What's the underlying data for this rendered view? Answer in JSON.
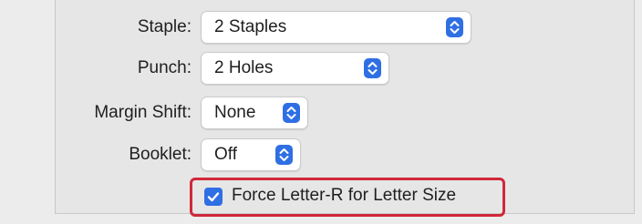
{
  "finishing": {
    "staple": {
      "label": "Staple:",
      "value": "2 Staples"
    },
    "punch": {
      "label": "Punch:",
      "value": "2 Holes"
    },
    "margin_shift": {
      "label": "Margin Shift:",
      "value": "None"
    },
    "booklet": {
      "label": "Booklet:",
      "value": "Off"
    },
    "force_letter_r": {
      "label": "Force Letter-R for Letter Size",
      "checked": true
    }
  },
  "colors": {
    "accent": "#2f6fe4",
    "highlight_border": "#d0283a",
    "panel_background": "#e6e6e6"
  },
  "icons": {
    "popup_stepper": "up-down-chevron-icon",
    "checkmark": "checkmark-icon"
  }
}
